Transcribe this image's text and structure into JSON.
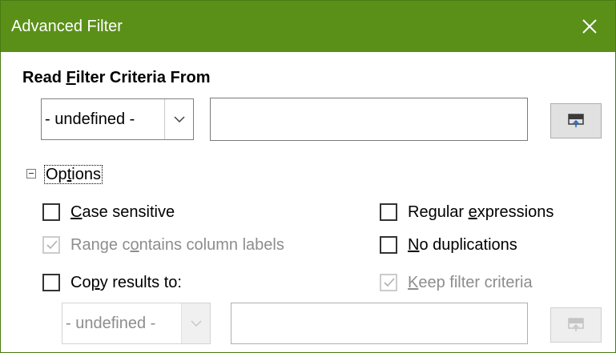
{
  "window": {
    "title": "Advanced Filter",
    "close_icon": "close-icon"
  },
  "filter_source": {
    "heading_before": "Read ",
    "heading_mnemonic": "F",
    "heading_after": "ilter Criteria From",
    "range_value": "- undefined -",
    "criteria_value": "",
    "shrink_icon": "shrink-icon"
  },
  "options": {
    "expander_label_before": "Op",
    "expander_label_mnemonic": "t",
    "expander_label_after": "ions",
    "expanded": true,
    "case_sensitive": {
      "label_mnemonic": "C",
      "label_after": "ase sensitive",
      "checked": false,
      "enabled": true
    },
    "regular_expressions": {
      "label_before": "Regular ",
      "label_mnemonic": "e",
      "label_after": "xpressions",
      "checked": false,
      "enabled": true
    },
    "range_contains_column_labels": {
      "label_before": "Range c",
      "label_mnemonic": "o",
      "label_after": "ntains column labels",
      "checked": true,
      "enabled": false
    },
    "no_duplications": {
      "label_mnemonic": "N",
      "label_after": "o duplications",
      "checked": false,
      "enabled": true
    },
    "copy_results_to": {
      "label_before": "Co",
      "label_mnemonic": "p",
      "label_after": "y results to:",
      "checked": false,
      "enabled": true,
      "range_value": "- undefined -",
      "destination_value": ""
    },
    "keep_filter_criteria": {
      "label_mnemonic": "K",
      "label_after": "eep filter criteria",
      "checked": true,
      "enabled": false
    }
  },
  "colors": {
    "title_bar": "#5a9018",
    "title_text": "#ffffff",
    "disabled_text": "#8d8d8d",
    "button_face": "#e1e1e1",
    "shrink_icon_accent": "#1f5fbf"
  }
}
